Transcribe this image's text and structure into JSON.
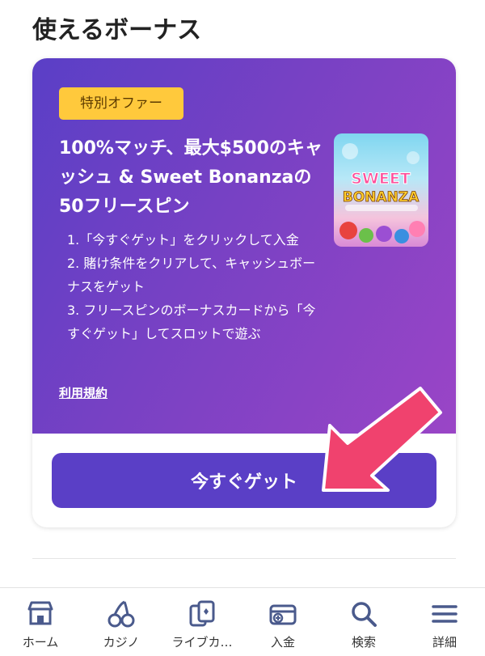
{
  "section": {
    "title": "使えるボーナス"
  },
  "offer": {
    "badge": "特別オファー",
    "title": "100%マッチ、最大$500のキャッシュ & Sweet Bonanzaの50フリースピン",
    "steps": [
      "1.「今すぐゲット」をクリックして入金",
      "2. 賭け条件をクリアして、キャッシュボーナスをゲット",
      "3. フリースピンのボーナスカードから「今すぐゲット」してスロットで遊ぶ"
    ],
    "terms_link": "利用規約",
    "cta": "今すぐゲット",
    "thumbnail_logo_line1": "SWEET",
    "thumbnail_logo_line2": "BONANZA"
  },
  "colors": {
    "card_gradient_start": "#5a3fc6",
    "card_gradient_end": "#9a45c6",
    "badge": "#ffc93c",
    "button": "#5a3fc6",
    "arrow": "#f0426e"
  },
  "bottom_nav": [
    {
      "label": "ホーム",
      "icon": "store-icon"
    },
    {
      "label": "カジノ",
      "icon": "cherries-icon"
    },
    {
      "label": "ライブカ…",
      "icon": "cards-icon"
    },
    {
      "label": "入金",
      "icon": "wallet-plus-icon"
    },
    {
      "label": "検索",
      "icon": "search-icon"
    },
    {
      "label": "詳細",
      "icon": "menu-icon"
    }
  ]
}
